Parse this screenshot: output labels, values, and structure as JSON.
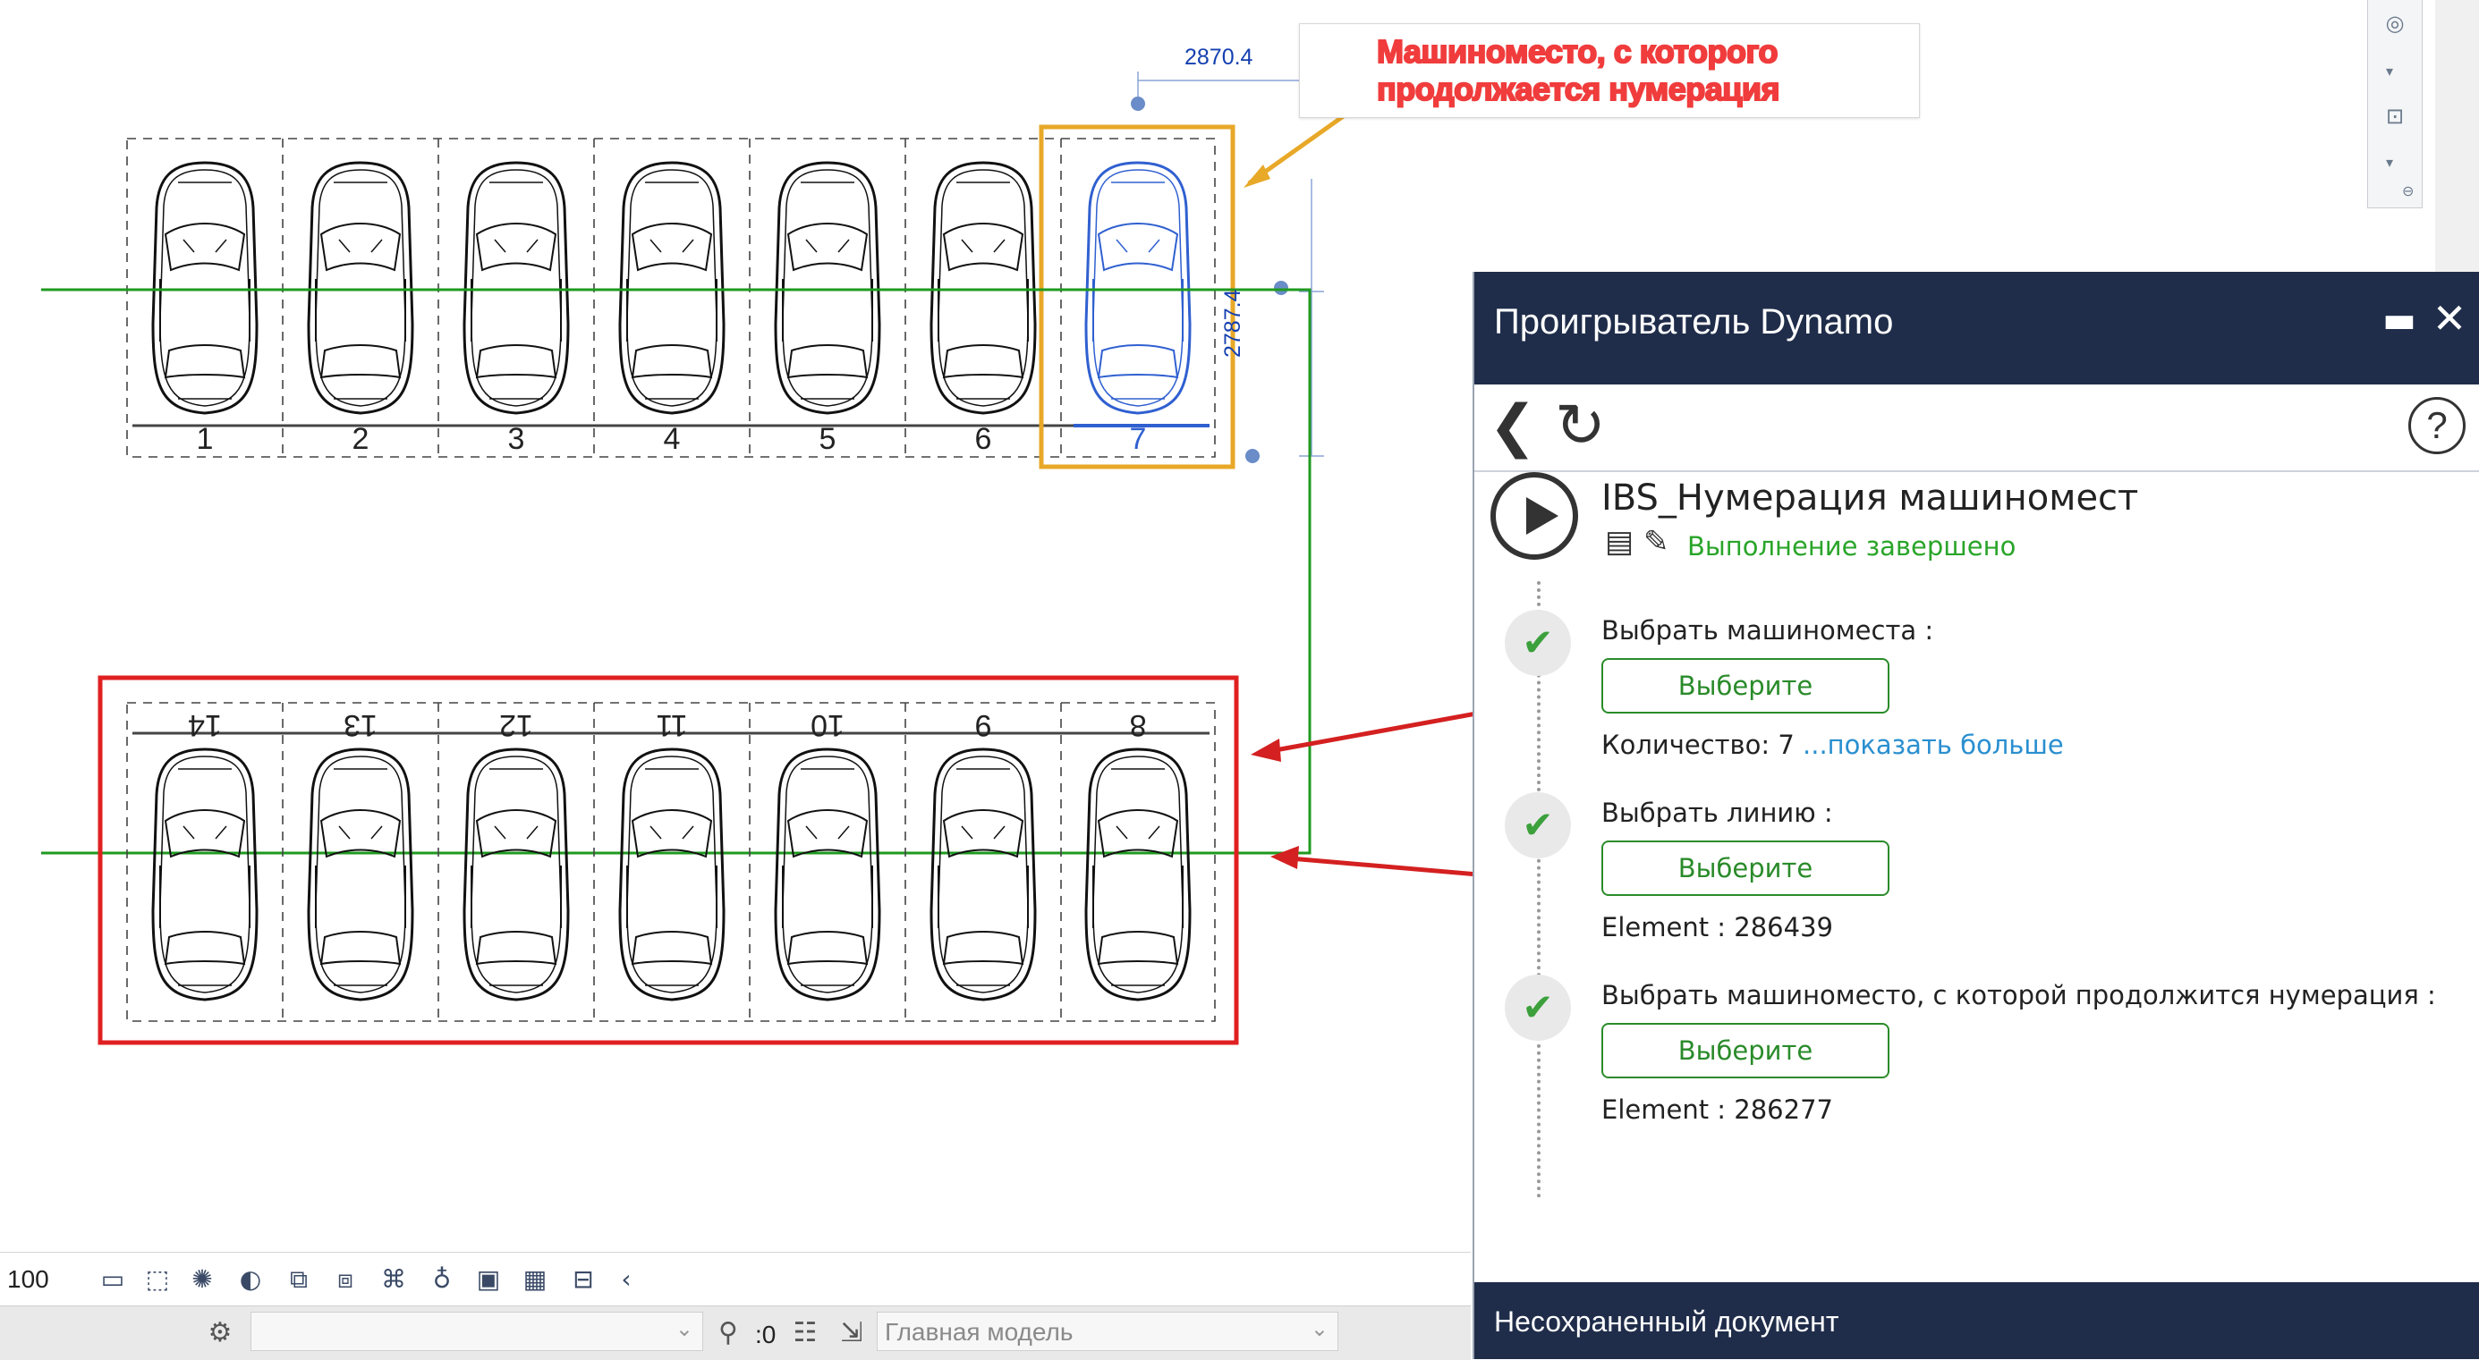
{
  "drawing": {
    "dimension_horizontal": "2870.4",
    "dimension_vertical": "2787.4",
    "callout_line1": "Машиноместо, с которого",
    "callout_line2": "продолжается нумерация",
    "top_row_numbers": [
      "1",
      "2",
      "3",
      "4",
      "5",
      "6",
      "7"
    ],
    "bottom_row_numbers": [
      "14",
      "13",
      "12",
      "11",
      "10",
      "9",
      "8"
    ],
    "colors": {
      "highlight_frame": "#e8a828",
      "selection_frame": "#e02020",
      "line": "#1f9a1f",
      "selected_car": "#3060d0",
      "dimension": "#1540b0"
    }
  },
  "view_strip": {
    "icons": [
      "steering-wheel-icon",
      "zoom-region-icon",
      "scroll-icon"
    ]
  },
  "player": {
    "title": "Проигрыватель Dynamo",
    "help_symbol": "?",
    "script_name": "IBS_Нумерация машиномест",
    "status": "Выполнение завершено",
    "steps": [
      {
        "label": "Выбрать машиноместа :",
        "button": "Выберите",
        "result": "Количество: 7",
        "link": "...показать больше"
      },
      {
        "label": "Выбрать линию :",
        "button": "Выберите",
        "result": "Element : 286439"
      },
      {
        "label": "Выбрать машиноместо, с которой продолжится нумерация :",
        "button": "Выберите",
        "result": "Element : 286277"
      }
    ],
    "footer": "Несохраненный документ"
  },
  "viewbar": {
    "scale": "100"
  },
  "statusbar": {
    "workset_value": "",
    "filter_count": ":0",
    "design_option": "Главная модель"
  }
}
